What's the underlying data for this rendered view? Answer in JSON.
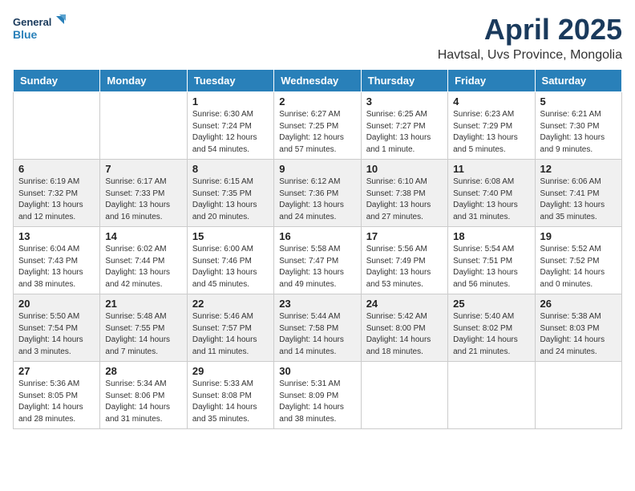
{
  "logo": {
    "line1": "General",
    "line2": "Blue"
  },
  "title": "April 2025",
  "location": "Havtsal, Uvs Province, Mongolia",
  "days_of_week": [
    "Sunday",
    "Monday",
    "Tuesday",
    "Wednesday",
    "Thursday",
    "Friday",
    "Saturday"
  ],
  "weeks": [
    [
      {
        "day": "",
        "sunrise": "",
        "sunset": "",
        "daylight": ""
      },
      {
        "day": "",
        "sunrise": "",
        "sunset": "",
        "daylight": ""
      },
      {
        "day": "1",
        "sunrise": "Sunrise: 6:30 AM",
        "sunset": "Sunset: 7:24 PM",
        "daylight": "Daylight: 12 hours and 54 minutes."
      },
      {
        "day": "2",
        "sunrise": "Sunrise: 6:27 AM",
        "sunset": "Sunset: 7:25 PM",
        "daylight": "Daylight: 12 hours and 57 minutes."
      },
      {
        "day": "3",
        "sunrise": "Sunrise: 6:25 AM",
        "sunset": "Sunset: 7:27 PM",
        "daylight": "Daylight: 13 hours and 1 minute."
      },
      {
        "day": "4",
        "sunrise": "Sunrise: 6:23 AM",
        "sunset": "Sunset: 7:29 PM",
        "daylight": "Daylight: 13 hours and 5 minutes."
      },
      {
        "day": "5",
        "sunrise": "Sunrise: 6:21 AM",
        "sunset": "Sunset: 7:30 PM",
        "daylight": "Daylight: 13 hours and 9 minutes."
      }
    ],
    [
      {
        "day": "6",
        "sunrise": "Sunrise: 6:19 AM",
        "sunset": "Sunset: 7:32 PM",
        "daylight": "Daylight: 13 hours and 12 minutes."
      },
      {
        "day": "7",
        "sunrise": "Sunrise: 6:17 AM",
        "sunset": "Sunset: 7:33 PM",
        "daylight": "Daylight: 13 hours and 16 minutes."
      },
      {
        "day": "8",
        "sunrise": "Sunrise: 6:15 AM",
        "sunset": "Sunset: 7:35 PM",
        "daylight": "Daylight: 13 hours and 20 minutes."
      },
      {
        "day": "9",
        "sunrise": "Sunrise: 6:12 AM",
        "sunset": "Sunset: 7:36 PM",
        "daylight": "Daylight: 13 hours and 24 minutes."
      },
      {
        "day": "10",
        "sunrise": "Sunrise: 6:10 AM",
        "sunset": "Sunset: 7:38 PM",
        "daylight": "Daylight: 13 hours and 27 minutes."
      },
      {
        "day": "11",
        "sunrise": "Sunrise: 6:08 AM",
        "sunset": "Sunset: 7:40 PM",
        "daylight": "Daylight: 13 hours and 31 minutes."
      },
      {
        "day": "12",
        "sunrise": "Sunrise: 6:06 AM",
        "sunset": "Sunset: 7:41 PM",
        "daylight": "Daylight: 13 hours and 35 minutes."
      }
    ],
    [
      {
        "day": "13",
        "sunrise": "Sunrise: 6:04 AM",
        "sunset": "Sunset: 7:43 PM",
        "daylight": "Daylight: 13 hours and 38 minutes."
      },
      {
        "day": "14",
        "sunrise": "Sunrise: 6:02 AM",
        "sunset": "Sunset: 7:44 PM",
        "daylight": "Daylight: 13 hours and 42 minutes."
      },
      {
        "day": "15",
        "sunrise": "Sunrise: 6:00 AM",
        "sunset": "Sunset: 7:46 PM",
        "daylight": "Daylight: 13 hours and 45 minutes."
      },
      {
        "day": "16",
        "sunrise": "Sunrise: 5:58 AM",
        "sunset": "Sunset: 7:47 PM",
        "daylight": "Daylight: 13 hours and 49 minutes."
      },
      {
        "day": "17",
        "sunrise": "Sunrise: 5:56 AM",
        "sunset": "Sunset: 7:49 PM",
        "daylight": "Daylight: 13 hours and 53 minutes."
      },
      {
        "day": "18",
        "sunrise": "Sunrise: 5:54 AM",
        "sunset": "Sunset: 7:51 PM",
        "daylight": "Daylight: 13 hours and 56 minutes."
      },
      {
        "day": "19",
        "sunrise": "Sunrise: 5:52 AM",
        "sunset": "Sunset: 7:52 PM",
        "daylight": "Daylight: 14 hours and 0 minutes."
      }
    ],
    [
      {
        "day": "20",
        "sunrise": "Sunrise: 5:50 AM",
        "sunset": "Sunset: 7:54 PM",
        "daylight": "Daylight: 14 hours and 3 minutes."
      },
      {
        "day": "21",
        "sunrise": "Sunrise: 5:48 AM",
        "sunset": "Sunset: 7:55 PM",
        "daylight": "Daylight: 14 hours and 7 minutes."
      },
      {
        "day": "22",
        "sunrise": "Sunrise: 5:46 AM",
        "sunset": "Sunset: 7:57 PM",
        "daylight": "Daylight: 14 hours and 11 minutes."
      },
      {
        "day": "23",
        "sunrise": "Sunrise: 5:44 AM",
        "sunset": "Sunset: 7:58 PM",
        "daylight": "Daylight: 14 hours and 14 minutes."
      },
      {
        "day": "24",
        "sunrise": "Sunrise: 5:42 AM",
        "sunset": "Sunset: 8:00 PM",
        "daylight": "Daylight: 14 hours and 18 minutes."
      },
      {
        "day": "25",
        "sunrise": "Sunrise: 5:40 AM",
        "sunset": "Sunset: 8:02 PM",
        "daylight": "Daylight: 14 hours and 21 minutes."
      },
      {
        "day": "26",
        "sunrise": "Sunrise: 5:38 AM",
        "sunset": "Sunset: 8:03 PM",
        "daylight": "Daylight: 14 hours and 24 minutes."
      }
    ],
    [
      {
        "day": "27",
        "sunrise": "Sunrise: 5:36 AM",
        "sunset": "Sunset: 8:05 PM",
        "daylight": "Daylight: 14 hours and 28 minutes."
      },
      {
        "day": "28",
        "sunrise": "Sunrise: 5:34 AM",
        "sunset": "Sunset: 8:06 PM",
        "daylight": "Daylight: 14 hours and 31 minutes."
      },
      {
        "day": "29",
        "sunrise": "Sunrise: 5:33 AM",
        "sunset": "Sunset: 8:08 PM",
        "daylight": "Daylight: 14 hours and 35 minutes."
      },
      {
        "day": "30",
        "sunrise": "Sunrise: 5:31 AM",
        "sunset": "Sunset: 8:09 PM",
        "daylight": "Daylight: 14 hours and 38 minutes."
      },
      {
        "day": "",
        "sunrise": "",
        "sunset": "",
        "daylight": ""
      },
      {
        "day": "",
        "sunrise": "",
        "sunset": "",
        "daylight": ""
      },
      {
        "day": "",
        "sunrise": "",
        "sunset": "",
        "daylight": ""
      }
    ]
  ]
}
